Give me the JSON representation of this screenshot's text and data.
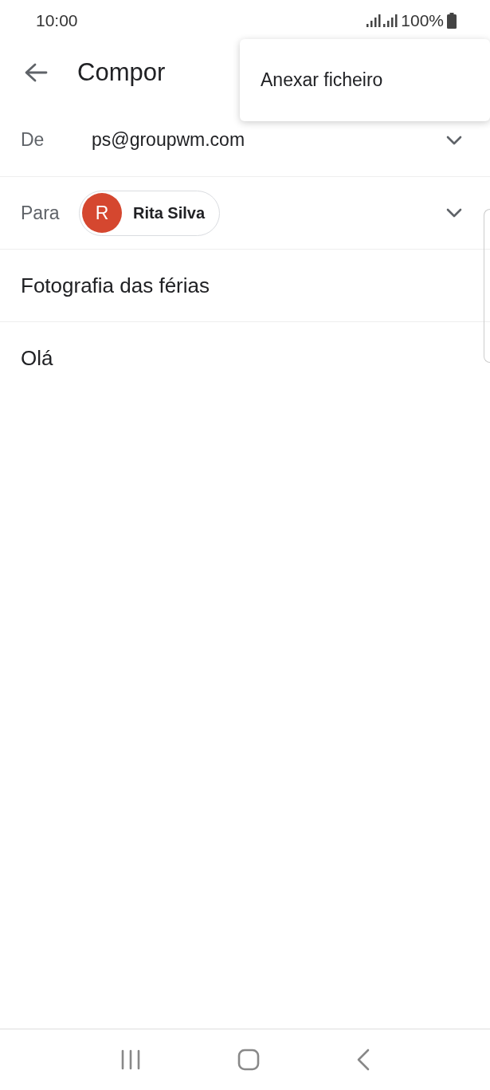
{
  "status_bar": {
    "time": "10:00",
    "battery": "100%"
  },
  "app_bar": {
    "title": "Compor"
  },
  "menu": {
    "items": [
      "Anexar ficheiro"
    ]
  },
  "from": {
    "label": "De",
    "value": "ps@groupwm.com"
  },
  "to": {
    "label": "Para",
    "recipients": [
      {
        "initial": "R",
        "name": "Rita Silva"
      }
    ]
  },
  "subject": {
    "value": "Fotografia das férias"
  },
  "body": {
    "value": "Olá"
  }
}
